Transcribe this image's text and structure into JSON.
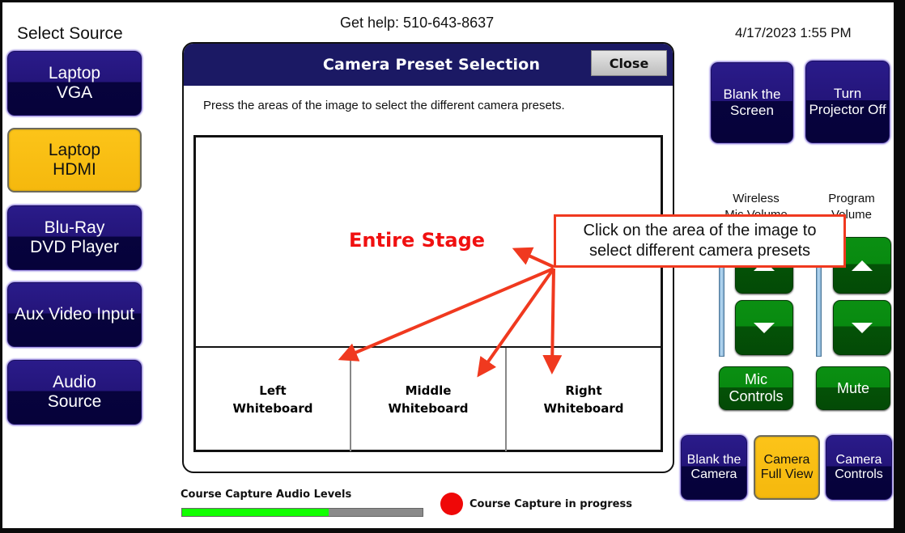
{
  "header": {
    "help_text": "Get help: 510-643-8637",
    "datetime": "4/17/2023 1:55 PM"
  },
  "sidebar": {
    "title": "Select Source",
    "sources": [
      {
        "line1": "Laptop",
        "line2": "VGA",
        "selected": false
      },
      {
        "line1": "Laptop",
        "line2": "HDMI",
        "selected": true
      },
      {
        "line1": "Blu-Ray",
        "line2": "DVD Player",
        "selected": false
      },
      {
        "line1": "Aux Video Input",
        "line2": "",
        "selected": false
      },
      {
        "line1": "Audio",
        "line2": "Source",
        "selected": false
      }
    ]
  },
  "modal": {
    "title": "Camera Preset Selection",
    "close_label": "Close",
    "instruction": "Press the areas of the image to select the different camera presets.",
    "presets": {
      "entire_stage": "Entire Stage",
      "whiteboards": [
        {
          "line1": "Left",
          "line2": "Whiteboard"
        },
        {
          "line1": "Middle",
          "line2": "Whiteboard"
        },
        {
          "line1": "Right",
          "line2": "Whiteboard"
        }
      ]
    }
  },
  "annotation": {
    "callout_line1": "Click on the area of the image to",
    "callout_line2": "select different camera presets",
    "color": "#f0391f"
  },
  "right_panel": {
    "blank_screen": {
      "line1": "Blank the",
      "line2": "Screen"
    },
    "projector_off": {
      "line1": "Turn",
      "line2": "Projector Off"
    },
    "wireless_mic_label": {
      "line1": "Wireless",
      "line2": "Mic Volume"
    },
    "program_volume_label": {
      "line1": "Program",
      "line2": "Volume"
    },
    "mic_controls": {
      "line1": "Mic",
      "line2": "Controls"
    },
    "mute_label": "Mute",
    "blank_camera": {
      "line1": "Blank the",
      "line2": "Camera"
    },
    "camera_full_view": {
      "line1": "Camera",
      "line2": "Full View",
      "selected": true
    },
    "camera_controls": {
      "line1": "Camera",
      "line2": "Controls"
    }
  },
  "footer": {
    "audio_levels_label": "Course Capture Audio Levels",
    "audio_level_percent": 61,
    "capture_status": "Course Capture in progress",
    "capture_indicator_color": "#ef0808"
  },
  "colors": {
    "button_blue": "#24157a",
    "button_yellow": "#fcc419",
    "button_green": "#088a10",
    "modal_header": "#1b1964",
    "audio_fill": "#11ff00"
  }
}
